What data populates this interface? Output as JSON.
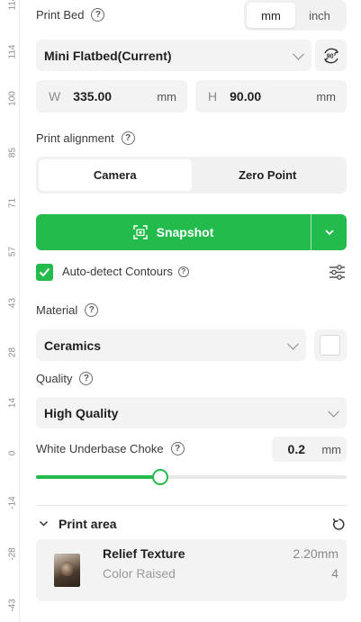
{
  "ruler": {
    "ticks": [
      "114",
      "100",
      "85",
      "71",
      "57",
      "43",
      "28",
      "14",
      "0",
      "-14",
      "-28",
      "-43"
    ]
  },
  "print_bed": {
    "label": "Print Bed",
    "units": [
      "mm",
      "inch"
    ],
    "selected_unit": "mm",
    "bed_type": "Mini Flatbed(Current)",
    "rotate_label": "90°",
    "width": {
      "prefix": "W",
      "value": "335.00",
      "unit": "mm"
    },
    "height": {
      "prefix": "H",
      "value": "90.00",
      "unit": "mm"
    }
  },
  "alignment": {
    "label": "Print alignment",
    "options": [
      "Camera",
      "Zero Point"
    ],
    "selected": "Camera"
  },
  "snapshot": {
    "label": "Snapshot"
  },
  "auto_detect": {
    "label": "Auto-detect Contours",
    "checked": true
  },
  "material": {
    "label": "Material",
    "value": "Ceramics",
    "color": "#ffffff"
  },
  "quality": {
    "label": "Quality",
    "value": "High Quality"
  },
  "underbase": {
    "label": "White Underbase Choke",
    "value": "0.2",
    "unit": "mm",
    "slider_fraction": 0.4
  },
  "print_area": {
    "label": "Print area",
    "items": [
      {
        "title": "Relief Texture",
        "subtitle": "Color Raised",
        "size": "2.20mm",
        "count": "4"
      }
    ]
  },
  "colors": {
    "accent": "#22bb4c"
  }
}
